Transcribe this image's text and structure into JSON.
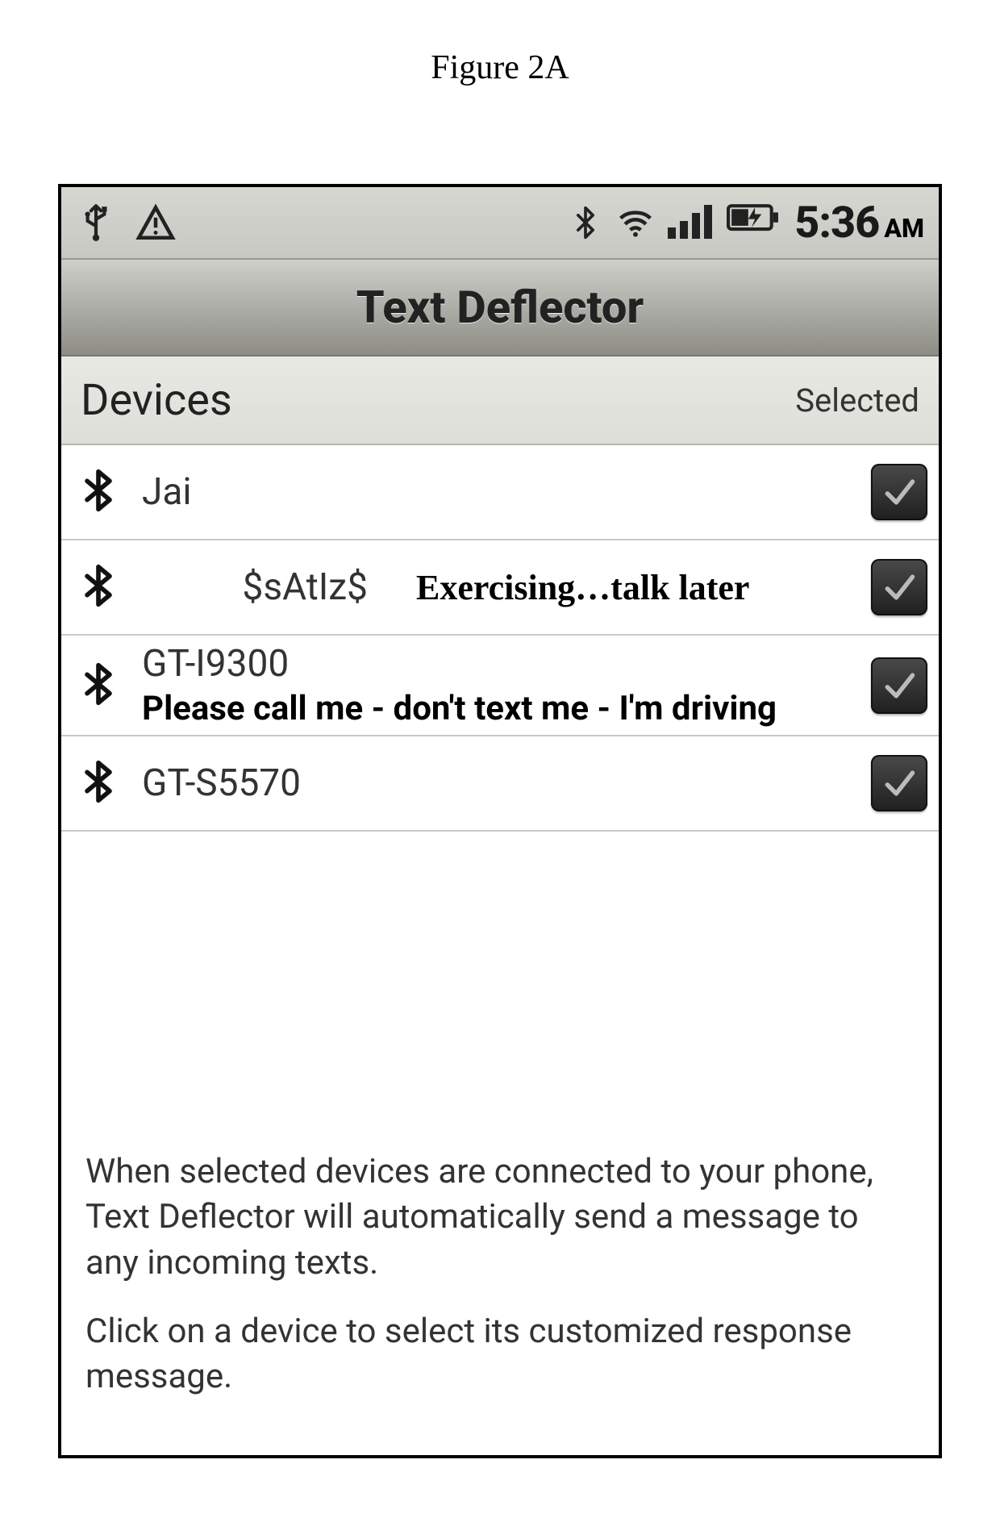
{
  "figure_label": "Figure 2A",
  "status": {
    "time": "5:36",
    "ampm": "AM",
    "icons": {
      "usb": "usb-icon",
      "warning": "warning-icon",
      "bluetooth": "bluetooth-icon",
      "wifi": "wifi-icon",
      "signal": "signal-icon",
      "battery": "battery-charging-icon"
    }
  },
  "app": {
    "title": "Text Deflector"
  },
  "section": {
    "title": "Devices",
    "selected_label": "Selected"
  },
  "devices": [
    {
      "name": "Jai",
      "message": "",
      "selected": true
    },
    {
      "name": "$sAtIz$",
      "message": "Exercising…talk later",
      "selected": true
    },
    {
      "name": "GT-I9300",
      "message": "Please call me - don't text me - I'm driving",
      "selected": true
    },
    {
      "name": "GT-S5570",
      "message": "",
      "selected": true
    }
  ],
  "info": {
    "para1": "When selected devices are connected to your phone, Text Deflector will automatically send a message to any incoming texts.",
    "para2": "Click on a device to select its customized response message."
  }
}
